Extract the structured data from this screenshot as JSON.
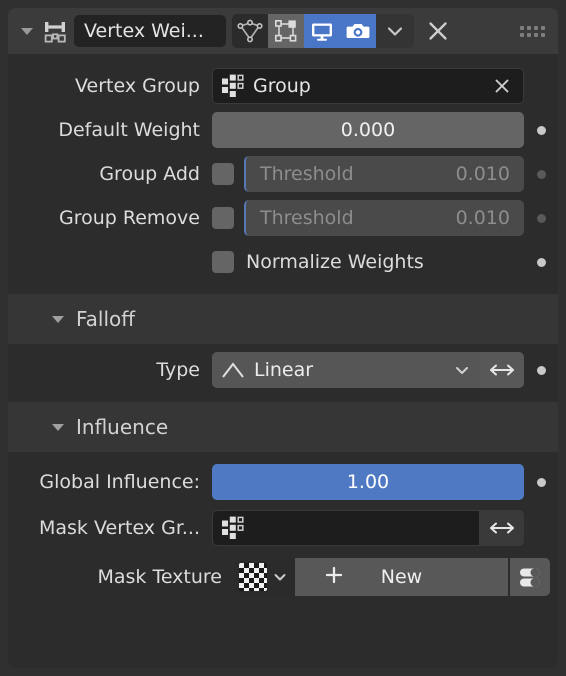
{
  "panel": {
    "modifier_name": "Vertex Wei...",
    "modifier_icon": "vertex-weight-edit-icon",
    "expand_triangle": "triangle-down-icon",
    "header_toggles": [
      {
        "name": "edit-mode-toggle",
        "icon": "editmode-hlt-icon",
        "state": "off"
      },
      {
        "name": "on-cage-toggle",
        "icon": "mod-cage-icon",
        "state": "grey"
      },
      {
        "name": "realtime-toggle",
        "icon": "monitor-icon",
        "state": "on"
      },
      {
        "name": "render-toggle",
        "icon": "camera-icon",
        "state": "on"
      },
      {
        "name": "extras-dropdown",
        "icon": "chevron-down-icon",
        "state": "chev"
      }
    ],
    "close_icon": "close-x-icon",
    "grip_icon": "drag-grip-icon"
  },
  "fields": {
    "vertex_group": {
      "label": "Vertex Group",
      "value": "Group",
      "icon": "group-vertex-icon",
      "clear_icon": "close-x-icon"
    },
    "default_weight": {
      "label": "Default Weight",
      "value": "0.000"
    },
    "group_add": {
      "label": "Group Add",
      "checked": false,
      "threshold_label": "Threshold",
      "threshold_value": "0.010",
      "enabled": false
    },
    "group_remove": {
      "label": "Group Remove",
      "checked": false,
      "threshold_label": "Threshold",
      "threshold_value": "0.010",
      "enabled": false
    },
    "normalize_weights": {
      "label": "Normalize Weights",
      "checked": false
    }
  },
  "falloff": {
    "section_title": "Falloff",
    "type_label": "Type",
    "type_value": "Linear",
    "type_icon": "linear-falloff-icon",
    "dropdown_icon": "chevron-down-icon",
    "invert_icon": "arrow-left-right-icon"
  },
  "influence": {
    "section_title": "Influence",
    "global_influence": {
      "label": "Global Influence:",
      "value": "1.00"
    },
    "mask_vertex_group": {
      "label": "Mask Vertex Gr...",
      "value": "",
      "icon": "group-vertex-icon",
      "invert_icon": "arrow-left-right-icon"
    },
    "mask_texture": {
      "label": "Mask Texture",
      "browse_icon": "texture-checker-icon",
      "browse_chevron": "chevron-down-icon",
      "add_icon": "plus-icon",
      "new_label": "New",
      "toggle_icon": "pill-list-toggle-icon"
    }
  },
  "colors": {
    "panel_bg": "#2c2c2c",
    "header_bg": "#3b3b3b",
    "subheader_bg": "#363636",
    "accent_blue": "#5079c4",
    "widget_grey": "#656565",
    "text": "#dcdcdc"
  }
}
